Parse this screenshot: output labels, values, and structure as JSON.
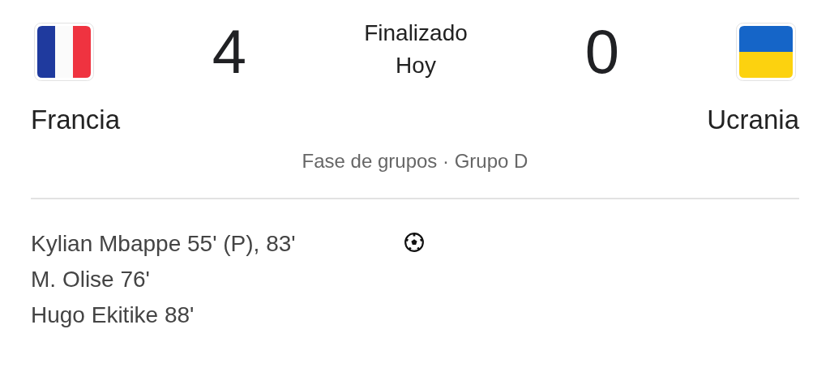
{
  "match": {
    "status": "Finalizado",
    "date": "Hoy",
    "stage": "Fase de grupos · Grupo D"
  },
  "teams": [
    {
      "name": "Francia",
      "score": "4"
    },
    {
      "name": "Ucrania",
      "score": "0"
    }
  ],
  "scorers": [
    {
      "kind": "goal",
      "text": "Kylian Mbappe 55' (P), 83'"
    },
    {
      "kind": "goal",
      "text": "M. Olise 76'"
    },
    {
      "kind": "goal",
      "text": "Hugo Ekitike 88'"
    }
  ]
}
